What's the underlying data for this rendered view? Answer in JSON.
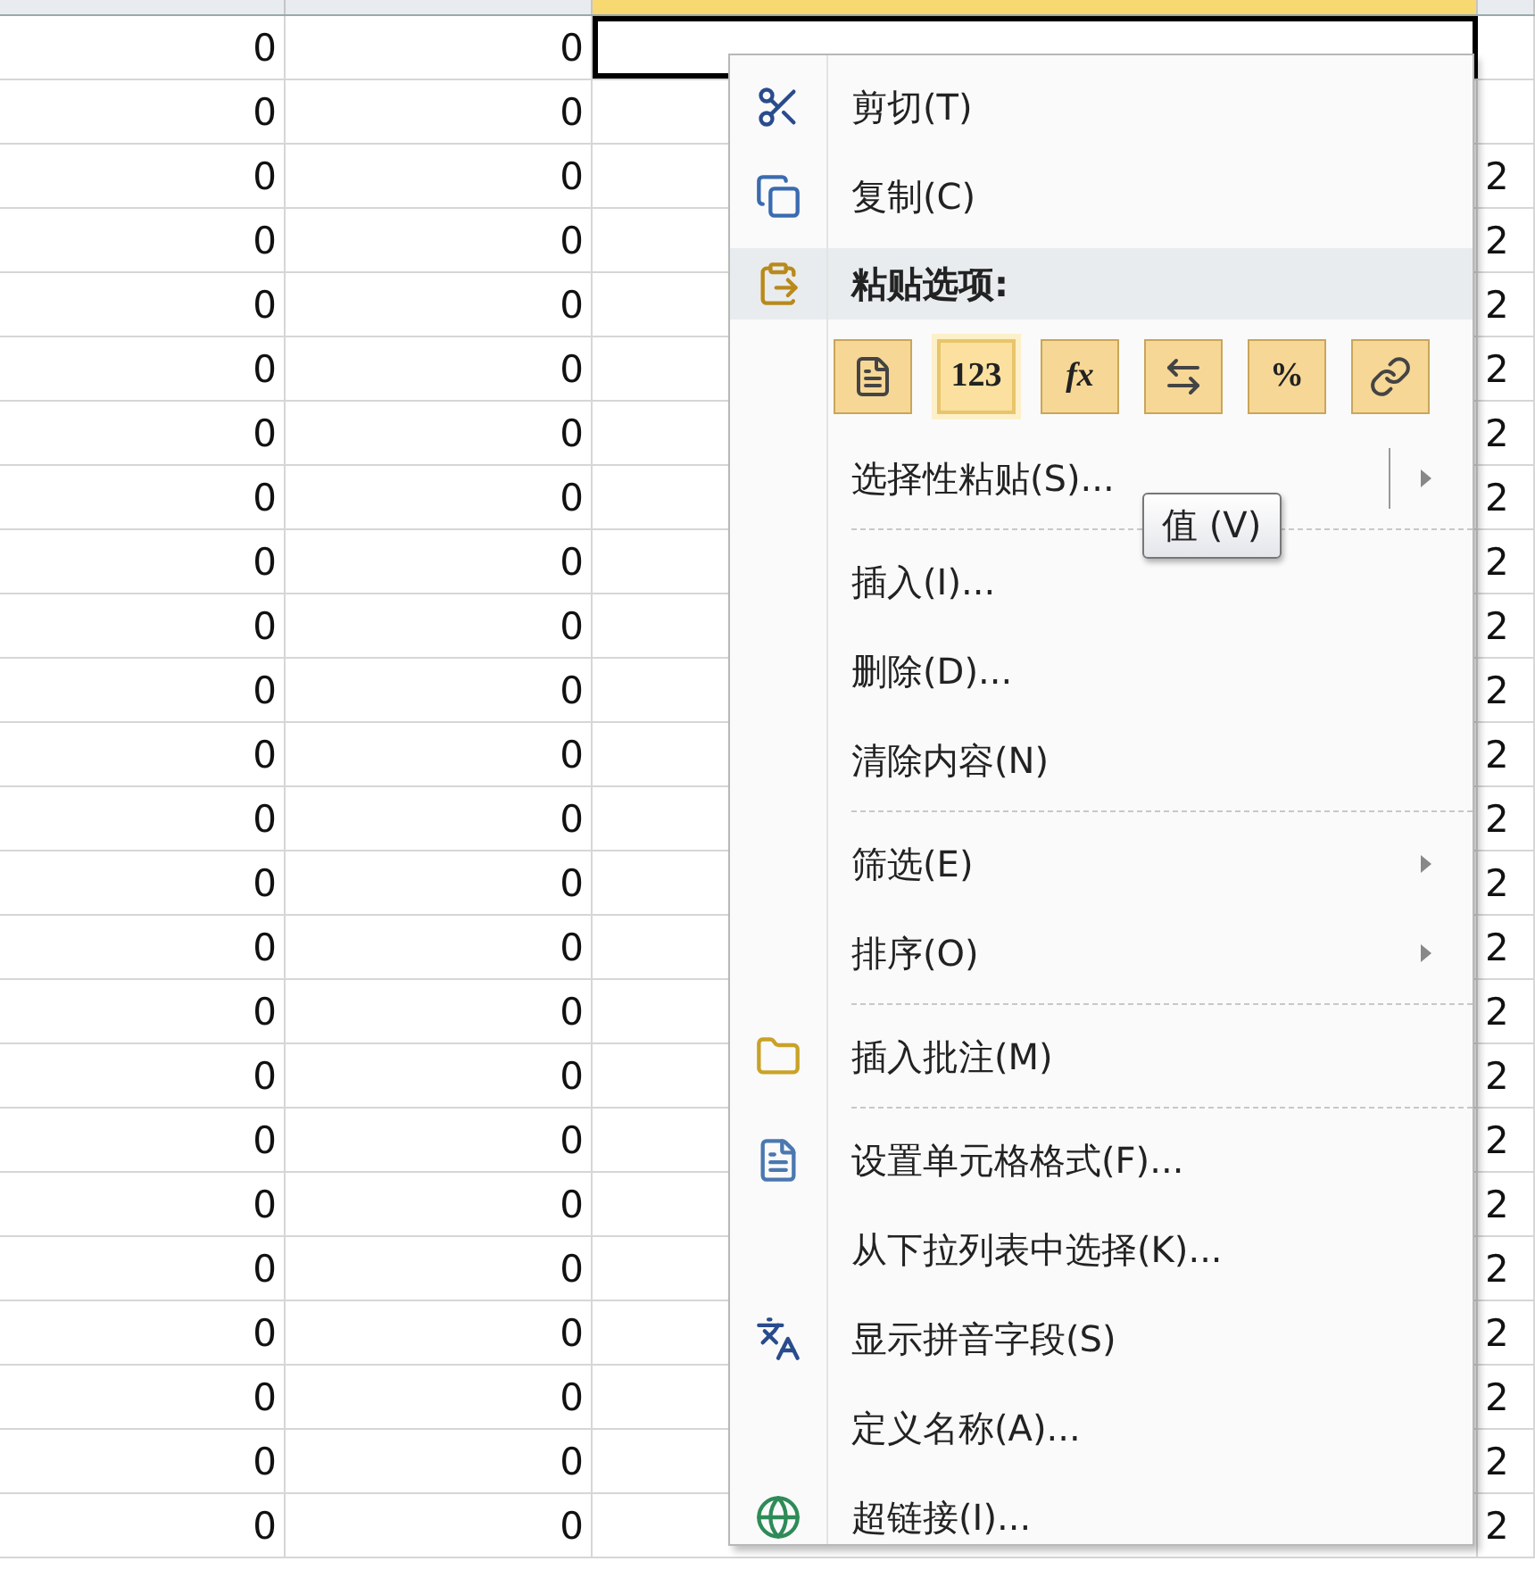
{
  "sheet": {
    "columns": [
      {
        "selected": false
      },
      {
        "selected": false
      },
      {
        "selected": true
      },
      {
        "selected": false
      }
    ],
    "rows": [
      {
        "cells": [
          "0",
          "0"
        ],
        "selected": true
      },
      {
        "cells": [
          "0",
          "0"
        ],
        "selected": false
      },
      {
        "cells": [
          "0",
          "0"
        ],
        "selected": false,
        "edge": "2"
      },
      {
        "cells": [
          "0",
          "0"
        ],
        "selected": false,
        "edge": "2"
      },
      {
        "cells": [
          "0",
          "0"
        ],
        "selected": false,
        "edge": "2"
      },
      {
        "cells": [
          "0",
          "0"
        ],
        "selected": false,
        "edge": "2"
      },
      {
        "cells": [
          "0",
          "0"
        ],
        "selected": false,
        "edge": "2"
      },
      {
        "cells": [
          "0",
          "0"
        ],
        "selected": false,
        "edge": "2"
      },
      {
        "cells": [
          "0",
          "0"
        ],
        "selected": false,
        "edge": "2"
      },
      {
        "cells": [
          "0",
          "0"
        ],
        "selected": false,
        "edge": "2"
      },
      {
        "cells": [
          "0",
          "0"
        ],
        "selected": false,
        "edge": "2"
      },
      {
        "cells": [
          "0",
          "0"
        ],
        "selected": false,
        "edge": "2"
      },
      {
        "cells": [
          "0",
          "0"
        ],
        "selected": false,
        "edge": "2"
      },
      {
        "cells": [
          "0",
          "0"
        ],
        "selected": false,
        "edge": "2"
      },
      {
        "cells": [
          "0",
          "0"
        ],
        "selected": false,
        "edge": "2"
      },
      {
        "cells": [
          "0",
          "0"
        ],
        "selected": false,
        "edge": "2"
      },
      {
        "cells": [
          "0",
          "0"
        ],
        "selected": false,
        "edge": "2"
      },
      {
        "cells": [
          "0",
          "0"
        ],
        "selected": false,
        "edge": "2"
      },
      {
        "cells": [
          "0",
          "0"
        ],
        "selected": false,
        "edge": "2"
      },
      {
        "cells": [
          "0",
          "0"
        ],
        "selected": false,
        "edge": "2"
      },
      {
        "cells": [
          "0",
          "0"
        ],
        "selected": false,
        "edge": "2"
      },
      {
        "cells": [
          "0",
          "0"
        ],
        "selected": false,
        "edge": "2"
      },
      {
        "cells": [
          "0",
          "0"
        ],
        "selected": false,
        "edge": "2"
      },
      {
        "cells": [
          "0",
          "0"
        ],
        "selected": false,
        "edge": "2"
      }
    ]
  },
  "context_menu": {
    "items": [
      {
        "kind": "item",
        "label": "剪切(T)"
      },
      {
        "kind": "item",
        "label": "复制(C)"
      },
      {
        "kind": "header",
        "label": "粘贴选项:"
      },
      {
        "kind": "paste_options",
        "options": [
          {
            "kind": "paste",
            "selected": false
          },
          {
            "kind": "values",
            "label": "123",
            "selected": true
          },
          {
            "kind": "formulas",
            "label": "fx",
            "selected": false
          },
          {
            "kind": "transpose",
            "selected": false
          },
          {
            "kind": "formatting",
            "label": "%",
            "selected": false
          },
          {
            "kind": "link",
            "selected": false
          }
        ]
      },
      {
        "kind": "item",
        "label": "选择性粘贴(S)...",
        "submenu": true,
        "split": true
      },
      {
        "kind": "separator"
      },
      {
        "kind": "item",
        "label": "插入(I)..."
      },
      {
        "kind": "item",
        "label": "删除(D)..."
      },
      {
        "kind": "item",
        "label": "清除内容(N)"
      },
      {
        "kind": "separator"
      },
      {
        "kind": "item",
        "label": "筛选(E)",
        "submenu": true
      },
      {
        "kind": "item",
        "label": "排序(O)",
        "submenu": true
      },
      {
        "kind": "separator"
      },
      {
        "kind": "item",
        "label": "插入批注(M)"
      },
      {
        "kind": "separator"
      },
      {
        "kind": "item",
        "label": "设置单元格格式(F)..."
      },
      {
        "kind": "item",
        "label": "从下拉列表中选择(K)..."
      },
      {
        "kind": "item",
        "label": "显示拼音字段(S)"
      },
      {
        "kind": "item",
        "label": "定义名称(A)..."
      },
      {
        "kind": "item",
        "label": "超链接(I)..."
      }
    ]
  },
  "tooltip": {
    "label": "值 (V)"
  }
}
